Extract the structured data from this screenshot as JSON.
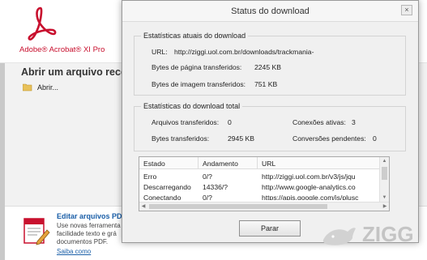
{
  "acrobat": {
    "brand": "Adobe® Acrobat® XI Pro",
    "open_title": "Abrir um arquivo recent",
    "open_item": "Abrir...",
    "edit_title": "Editar arquivos PDF",
    "edit_lines": [
      "Use novas ferramenta",
      "facilidade texto e grá",
      "documentos PDF."
    ],
    "learn_more": "Saiba como",
    "brand_color": "#c8102e"
  },
  "dialog": {
    "title": "Status do download",
    "close_glyph": "×",
    "current_stats": {
      "label": "Estatísticas atuais do download",
      "url_label": "URL:",
      "url_value": "http://ziggi.uol.com.br/downloads/trackmania-",
      "page_bytes_label": "Bytes de página transferidos:",
      "page_bytes_value": "2245 KB",
      "image_bytes_label": "Bytes de imagem transferidos:",
      "image_bytes_value": "751 KB"
    },
    "total_stats": {
      "label": "Estatísticas do download total",
      "files_label": "Arquivos transferidos:",
      "files_value": "0",
      "active_label": "Conexões ativas:",
      "active_value": "3",
      "bytes_label": "Bytes transferidos:",
      "bytes_value": "2945 KB",
      "pending_label": "Conversões pendentes:",
      "pending_value": "0"
    },
    "table": {
      "headers": [
        "Estado",
        "Andamento",
        "URL"
      ],
      "rows": [
        [
          "Erro",
          "0/?",
          "http://ziggi.uol.com.br/v3/js/jqu"
        ],
        [
          "Descarregando",
          "14336/?",
          "http://www.google-analytics.co"
        ],
        [
          "Conectando",
          "0/?",
          "https://apis.google.com/js/plusc"
        ]
      ]
    },
    "stop_label": "Parar"
  },
  "watermark": {
    "text": "ZIGG",
    "color": "#c4c4c4"
  }
}
